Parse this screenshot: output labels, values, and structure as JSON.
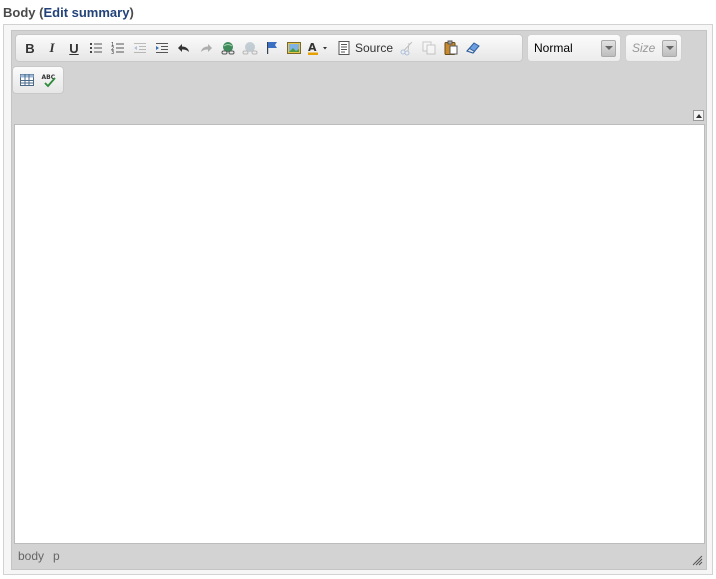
{
  "field": {
    "label": "Body",
    "open_paren": "(",
    "link": "Edit summary",
    "close_paren": ")"
  },
  "toolbar": {
    "bold": "B",
    "italic": "I",
    "underline": "U",
    "source_label": "Source",
    "format_value": "Normal",
    "size_placeholder": "Size"
  },
  "statusbar": {
    "path": [
      "body",
      "p"
    ]
  },
  "icons": {
    "bulleted_list": "bulleted-list-icon",
    "numbered_list": "numbered-list-icon",
    "outdent": "outdent-icon",
    "indent": "indent-icon",
    "undo": "undo-icon",
    "redo": "redo-icon",
    "link": "link-icon",
    "unlink": "unlink-icon",
    "anchor": "anchor-icon",
    "image": "image-icon",
    "text_color": "text-color-icon",
    "source": "source-icon",
    "cut": "cut-icon",
    "copy": "copy-icon",
    "paste": "paste-icon",
    "remove_format": "eraser-icon",
    "table": "table-icon",
    "spellcheck": "spellcheck-icon"
  },
  "colors": {
    "link": "#22427a",
    "toolbar_bg": "#d3d3d3",
    "content_bg": "#ffffff"
  }
}
